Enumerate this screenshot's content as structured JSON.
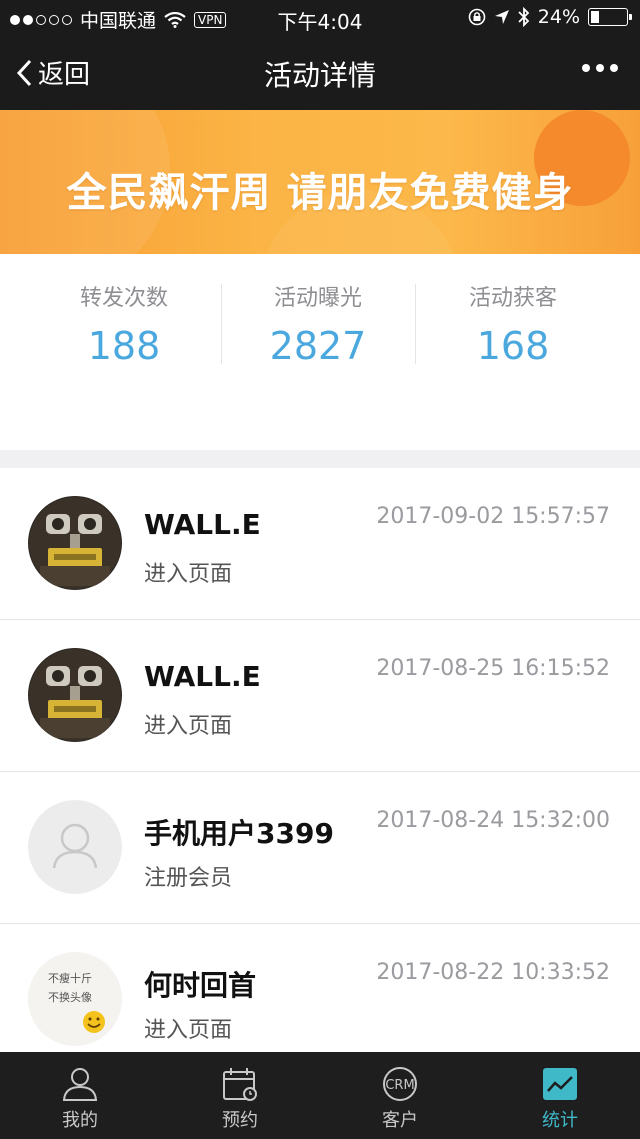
{
  "status_bar": {
    "carrier": "中国联通",
    "vpn": "VPN",
    "time": "下午4:04",
    "battery": "24%",
    "battery_level": 0.24
  },
  "nav": {
    "back_label": "返回",
    "title": "活动详情"
  },
  "banner": {
    "headline": "全民飙汗周 请朋友免费健身"
  },
  "stats": [
    {
      "label": "转发次数",
      "value": "188"
    },
    {
      "label": "活动曝光",
      "value": "2827"
    },
    {
      "label": "活动获客",
      "value": "168"
    }
  ],
  "visitors": [
    {
      "name": "WALL.E",
      "action": "进入页面",
      "time": "2017-09-02 15:57:57",
      "avatar": "robot"
    },
    {
      "name": "WALL.E",
      "action": "进入页面",
      "time": "2017-08-25 16:15:52",
      "avatar": "robot"
    },
    {
      "name": "手机用户3399",
      "action": "注册会员",
      "time": "2017-08-24 15:32:00",
      "avatar": "default"
    },
    {
      "name": "何时回首",
      "action": "进入页面",
      "time": "2017-08-22 10:33:52",
      "avatar": "text",
      "avatar_text": [
        "不瘦十斤",
        "不换头像"
      ]
    }
  ],
  "tabs": [
    {
      "label": "我的",
      "icon": "person-icon"
    },
    {
      "label": "预约",
      "icon": "calendar-icon"
    },
    {
      "label": "客户",
      "icon": "crm-icon",
      "icon_text": "CRM"
    },
    {
      "label": "统计",
      "icon": "chart-icon"
    }
  ],
  "active_tab": "统计"
}
